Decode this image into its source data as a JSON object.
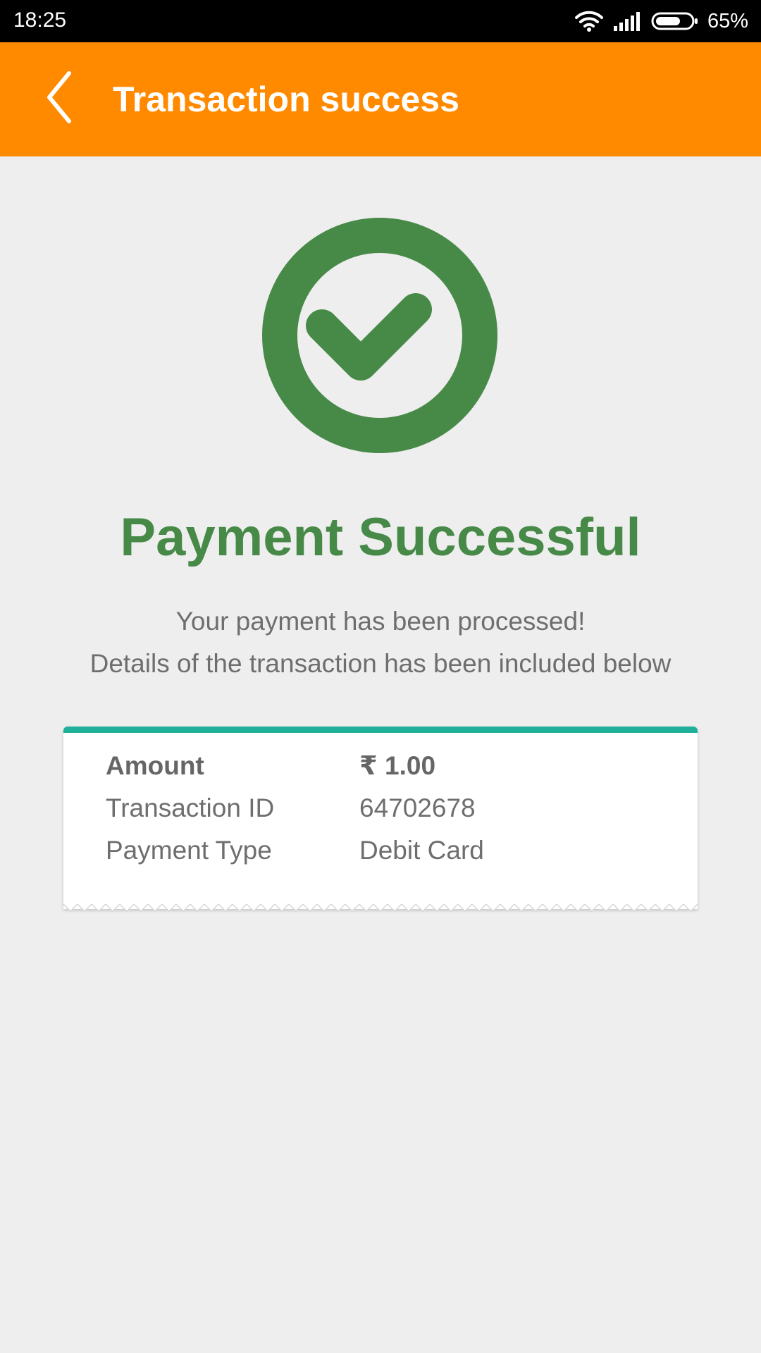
{
  "status_bar": {
    "time": "18:25",
    "battery_percent": "65%",
    "icons": [
      "wifi-icon",
      "signal-icon",
      "battery-icon"
    ]
  },
  "app_bar": {
    "title": "Transaction success",
    "back_icon": "chevron-left-icon",
    "background_color": "#ff8a00"
  },
  "main": {
    "status_icon": "check-circle-icon",
    "headline": "Payment Successful",
    "message_line1": "Your payment has been processed!",
    "message_line2": "Details of the transaction has been included below",
    "accent_color": "#478a48"
  },
  "receipt": {
    "accent_color": "#1fb09a",
    "rows": [
      {
        "label": "Amount",
        "value": "₹ 1.00"
      },
      {
        "label": "Transaction ID",
        "value": "64702678"
      },
      {
        "label": "Payment Type",
        "value": "Debit Card"
      }
    ]
  }
}
